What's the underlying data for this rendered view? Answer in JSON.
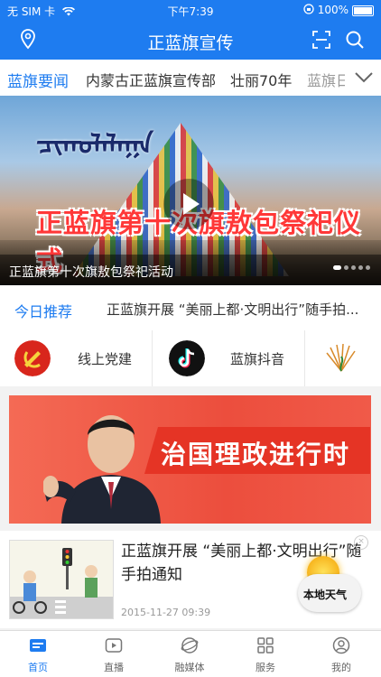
{
  "status_bar": {
    "carrier": "无 SIM 卡",
    "time": "下午7:39",
    "battery": "100%"
  },
  "header": {
    "title": "正蓝旗宣传"
  },
  "channels": [
    {
      "label": "蓝旗要闻",
      "active": true
    },
    {
      "label": "内蒙古正蓝旗宣传部",
      "active": false
    },
    {
      "label": "壮丽70年",
      "active": false
    },
    {
      "label": "蓝旗日",
      "active": false
    }
  ],
  "banner": {
    "headline": "正蓝旗第十次旗敖包祭祀仪式",
    "mongolian_text": "ᠴᠢᠬᠤᠯᠠᠯᠠᠭᠠ",
    "caption": "正蓝旗第十次旗敖包祭祀活动",
    "slide_count": 5,
    "active_slide": 1
  },
  "recommend": {
    "label": "今日推荐",
    "text": "正蓝旗开展 “美丽上都·文明出行”随手拍..."
  },
  "quick_links": [
    {
      "label": "线上党建",
      "icon": "party-emblem-icon"
    },
    {
      "label": "蓝旗抖音",
      "icon": "tiktok-icon"
    },
    {
      "label": "",
      "icon": "peacock-logo-icon"
    }
  ],
  "ad": {
    "slogan": "治国理政进行时"
  },
  "news": [
    {
      "title": "正蓝旗开展 “美丽上都·文明出行”随手拍通知",
      "time": "2015-11-27 09:39"
    }
  ],
  "weather_widget": {
    "label": "本地天气"
  },
  "tabbar": [
    {
      "label": "首页",
      "icon": "home-icon",
      "active": true
    },
    {
      "label": "直播",
      "icon": "live-icon",
      "active": false
    },
    {
      "label": "融媒体",
      "icon": "media-icon",
      "active": false
    },
    {
      "label": "服务",
      "icon": "services-icon",
      "active": false
    },
    {
      "label": "我的",
      "icon": "profile-icon",
      "active": false
    }
  ],
  "colors": {
    "brand": "#1e7cf0",
    "headline_red": "#ff3838",
    "ad_red": "#ec4e3d"
  }
}
